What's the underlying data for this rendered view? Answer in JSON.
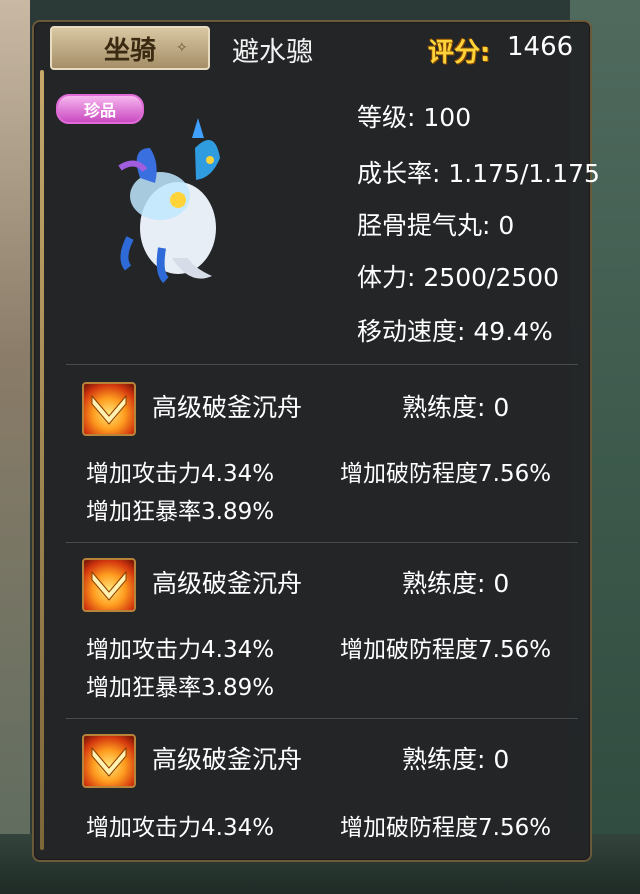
{
  "tab_label": "坐骑",
  "mount_name": "避水骢",
  "score": {
    "label": "评分:",
    "value": "1466"
  },
  "rarity_badge": "珍品",
  "stats": {
    "level": {
      "label": "等级:",
      "value": "100"
    },
    "growth": {
      "label": "成长率:",
      "value": "1.175/1.175"
    },
    "bone_pill": {
      "label": "胫骨提气丸:",
      "value": "0"
    },
    "stamina": {
      "label": "体力:",
      "value": "2500/2500"
    },
    "speed": {
      "label": "移动速度:",
      "value": "49.4%"
    }
  },
  "skills": [
    {
      "name": "高级破釜沉舟",
      "proficiency": "熟练度: 0",
      "effects": [
        "增加攻击力4.34%",
        "增加破防程度7.56%",
        "增加狂暴率3.89%"
      ]
    },
    {
      "name": "高级破釜沉舟",
      "proficiency": "熟练度: 0",
      "effects": [
        "增加攻击力4.34%",
        "增加破防程度7.56%",
        "增加狂暴率3.89%"
      ]
    },
    {
      "name": "高级破釜沉舟",
      "proficiency": "熟练度: 0",
      "effects": [
        "增加攻击力4.34%",
        "增加破防程度7.56%"
      ]
    }
  ],
  "colors": {
    "score_label": "#ffd43a",
    "panel_bg": "#222426",
    "tab_bg": "#c9b58f"
  },
  "icons": {
    "skill": "flame-chevron-icon",
    "mount": "water-dragon-horse-portrait"
  }
}
